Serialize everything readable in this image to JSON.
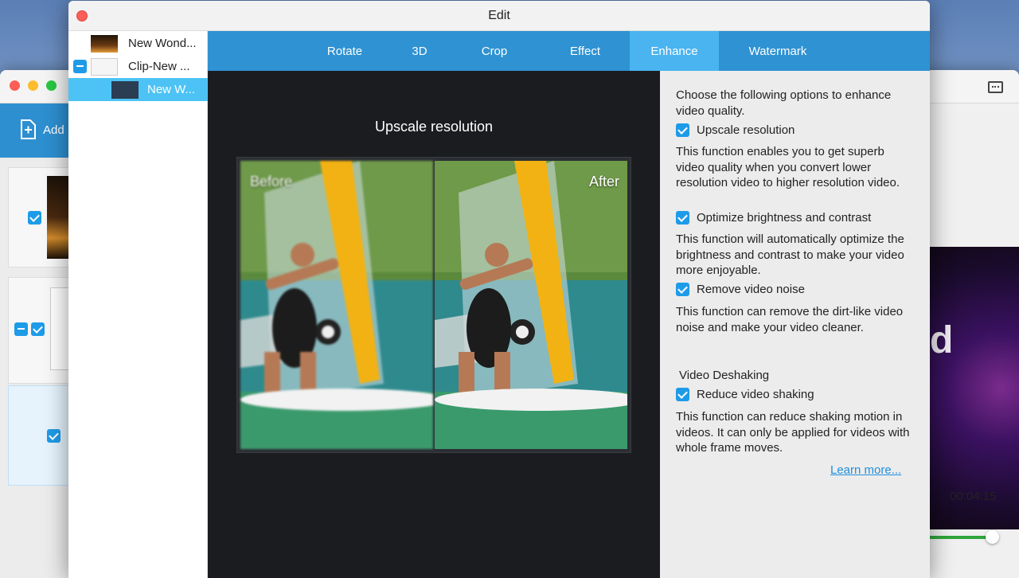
{
  "background_app": {
    "toolbar": {
      "add_label": "Add"
    },
    "time_display": "00:04:15"
  },
  "dialog": {
    "title": "Edit",
    "files": [
      {
        "label": "New Wond...",
        "selected": false
      },
      {
        "label": "Clip-New ...",
        "selected": false
      },
      {
        "label": "New W...",
        "selected": true
      }
    ],
    "tabs": [
      {
        "label": "Rotate",
        "active": false
      },
      {
        "label": "3D",
        "active": false
      },
      {
        "label": "Crop",
        "active": false
      },
      {
        "label": "Effect",
        "active": false
      },
      {
        "label": "Enhance",
        "active": true
      },
      {
        "label": "Watermark",
        "active": false
      }
    ],
    "preview": {
      "title": "Upscale resolution",
      "before_label": "Before",
      "after_label": "After"
    },
    "options": {
      "intro": "Choose the following options to enhance video quality.",
      "upscale": {
        "label": "Upscale resolution",
        "checked": true,
        "desc": "This function enables you to get superb video quality when you convert lower resolution video to higher resolution video."
      },
      "brightness": {
        "label": "Optimize brightness and contrast",
        "checked": true,
        "desc": "This function will automatically optimize the brightness and contrast to make your video more enjoyable."
      },
      "noise": {
        "label": "Remove video noise",
        "checked": true,
        "desc": "This function can remove the dirt-like video noise and make your video cleaner."
      },
      "deshake_heading": "Video Deshaking",
      "deshake": {
        "label": "Reduce video shaking",
        "checked": true,
        "desc": "This function can reduce shaking motion in videos. It can only be applied for videos with whole frame moves."
      },
      "learn_more": "Learn more..."
    }
  },
  "colors": {
    "accent": "#2f92d2",
    "active_tab": "#49b4f0",
    "link": "#1f8fde"
  }
}
